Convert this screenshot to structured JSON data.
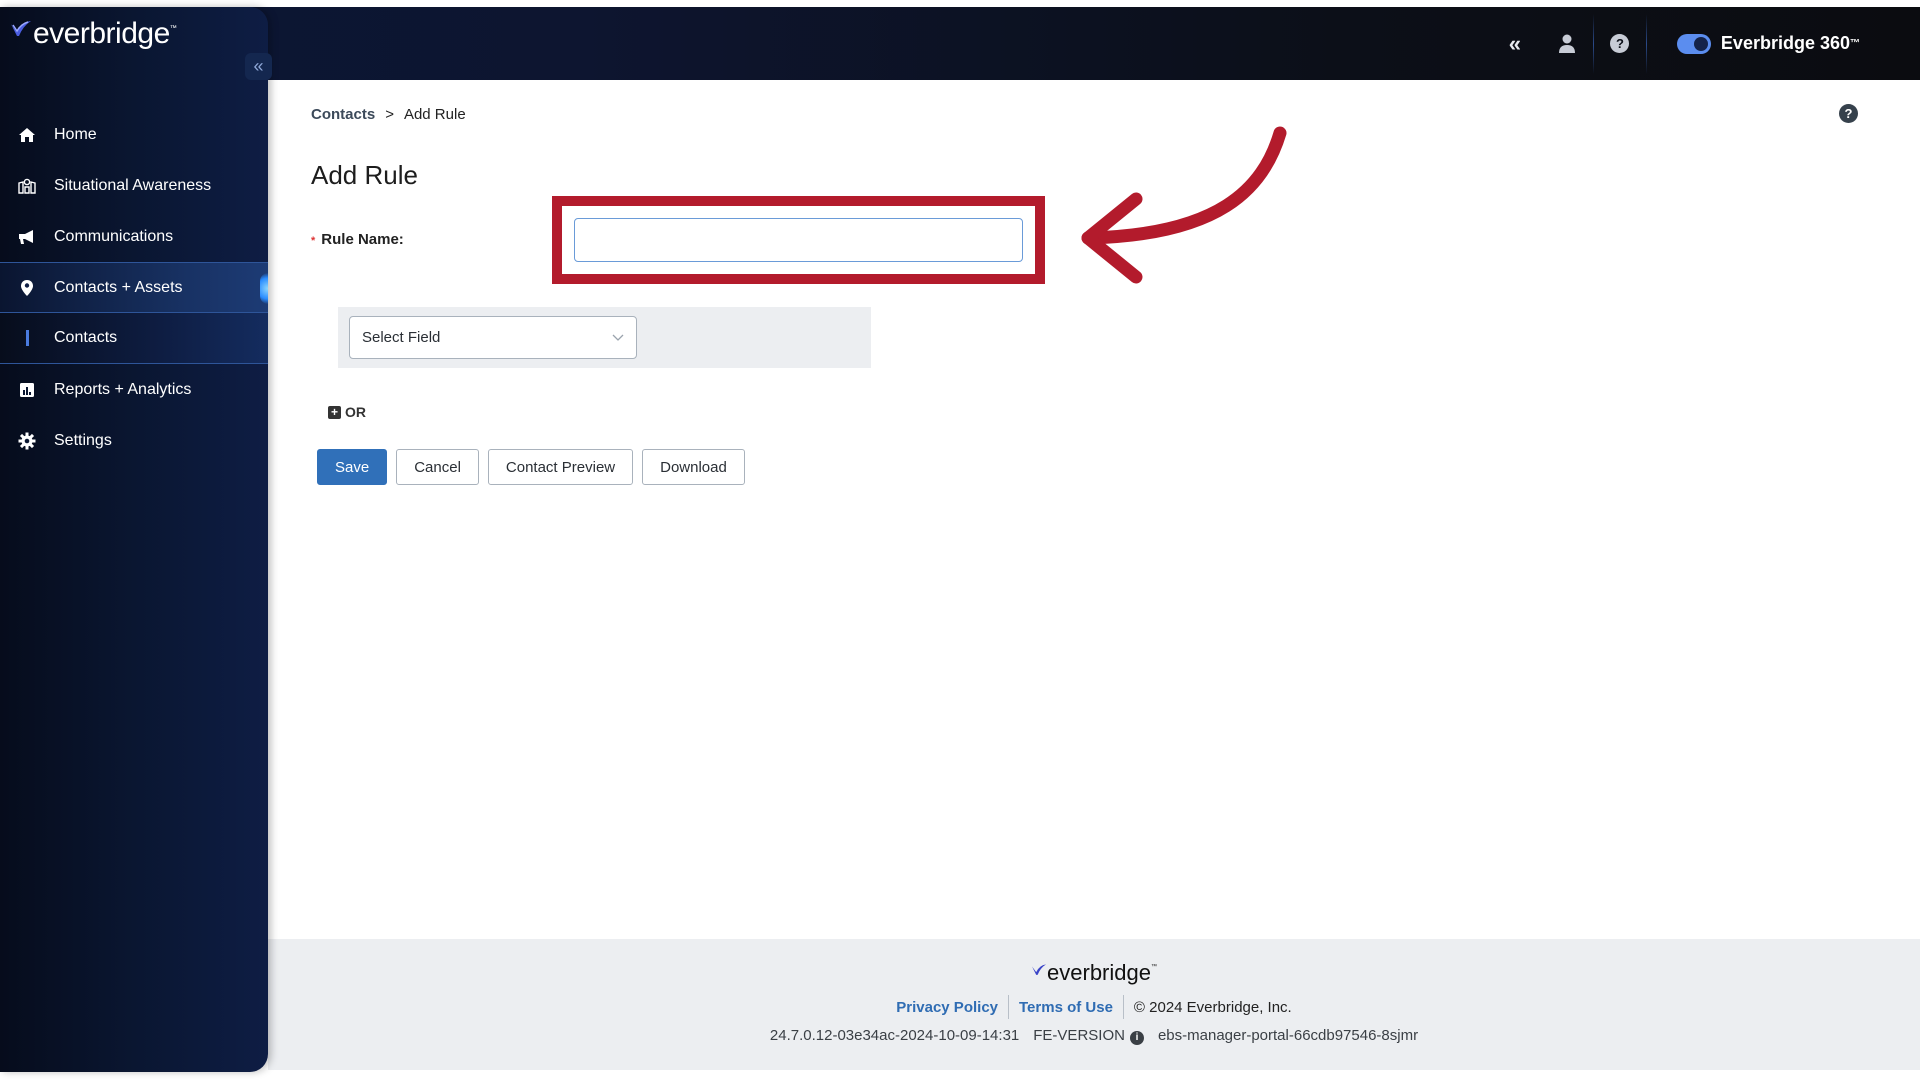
{
  "brand": {
    "logo_text": "everbridge",
    "logo_tm": "™",
    "product_label": "Everbridge 360",
    "product_tm": "™",
    "accent": "#5b8def"
  },
  "topbar": {
    "icons": [
      "collapse-icon",
      "user-icon",
      "help-icon"
    ],
    "collapse_glyph": "«",
    "help_glyph": "?"
  },
  "sidebar": {
    "collapse_glyph": "«",
    "items": [
      {
        "label": "Home",
        "icon": "home-icon"
      },
      {
        "label": "Situational Awareness",
        "icon": "map-icon"
      },
      {
        "label": "Communications",
        "icon": "megaphone-icon"
      },
      {
        "label": "Contacts + Assets",
        "icon": "location-pin-icon",
        "active": true
      },
      {
        "label": "Contacts",
        "sub": true,
        "active": true
      },
      {
        "label": "Reports + Analytics",
        "icon": "chart-icon"
      },
      {
        "label": "Settings",
        "icon": "gear-icon"
      }
    ]
  },
  "breadcrumb": {
    "parent": "Contacts",
    "separator": ">",
    "current": "Add Rule"
  },
  "page": {
    "title": "Add Rule",
    "help_glyph": "?",
    "rule_name_label": "Rule Name:",
    "required_marker": "*",
    "rule_name_value": "",
    "select_field_placeholder": "Select Field",
    "or_label": "OR",
    "buttons": {
      "save": "Save",
      "cancel": "Cancel",
      "preview": "Contact Preview",
      "download": "Download"
    }
  },
  "annotation": {
    "color": "#b31b2c",
    "target": "rule-name-input"
  },
  "footer": {
    "logo_text": "everbridge",
    "logo_tm": "™",
    "privacy": "Privacy Policy",
    "terms": "Terms of Use",
    "copyright": "© 2024 Everbridge, Inc.",
    "build": "24.7.0.12-03e34ac-2024-10-09-14:31",
    "fe_version_label": "FE-VERSION",
    "info_glyph": "i",
    "pod": "ebs-manager-portal-66cdb97546-8sjmr"
  }
}
